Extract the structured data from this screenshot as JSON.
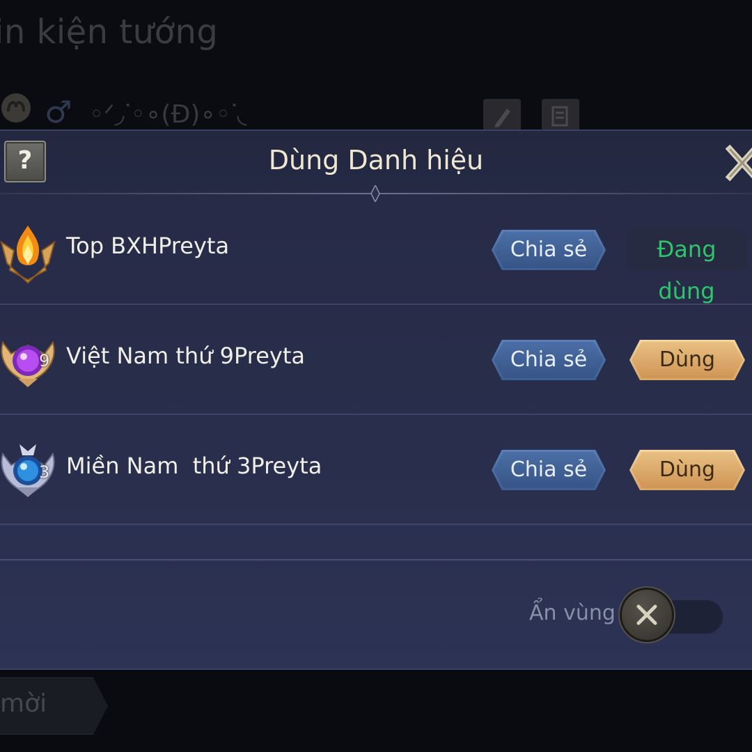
{
  "background": {
    "page_title": "in kiện tướng",
    "ornament_text": "◦ᐟ◞ᐝ◦∘(Đ)∘◦ᐝ◟",
    "new_button_label": "mời"
  },
  "modal": {
    "title": "Dùng Danh hiệu",
    "help_glyph": "?",
    "titles": [
      {
        "name": "Top BXHPreyta",
        "badge": "gold-flame-badge",
        "share_label": "Chia sẻ",
        "status": "Đang dùng",
        "status_color": "#2ec56b"
      },
      {
        "name": "Việt Nam thứ 9Preyta",
        "badge": "purple-gem-badge",
        "rank": "9",
        "share_label": "Chia sẻ",
        "use_label": "Dùng"
      },
      {
        "name": "Miền Nam  thứ 3Preyta",
        "badge": "blue-gem-badge",
        "rank": "3",
        "share_label": "Chia sẻ",
        "use_label": "Dùng"
      }
    ],
    "hide_region_label": "Ẩn vùng",
    "hide_region_enabled": false
  },
  "colors": {
    "modal_bg": "#292e4c",
    "share_button": "#4a6ea5",
    "use_button": "#e8bf82",
    "in_use_text": "#2ec56b",
    "title_text": "#efe7d2"
  }
}
